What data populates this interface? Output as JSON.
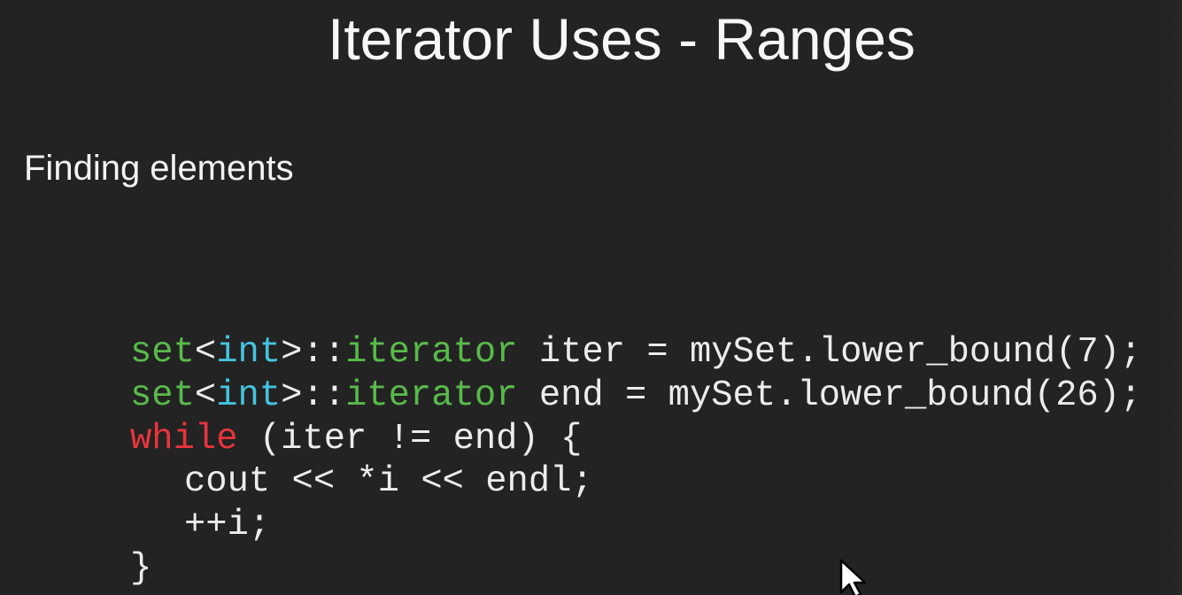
{
  "slide": {
    "title": "Iterator Uses - Ranges",
    "subtitle": "Finding elements"
  },
  "code": {
    "line1": {
      "type": "set",
      "lt": "<",
      "int": "int",
      "gt_scope": ">::",
      "iterator": "iterator",
      "rest": " iter = mySet.lower_bound(7);"
    },
    "line2": {
      "type": "set",
      "lt": "<",
      "int": "int",
      "gt_scope": ">::",
      "iterator": "iterator",
      "rest": " end = mySet.lower_bound(26);"
    },
    "line3": {
      "keyword": "while",
      "rest": " (iter != end) {"
    },
    "line4": "cout << *i << endl;",
    "line5": "++i;",
    "line6": "}"
  },
  "colors": {
    "background": "#232323",
    "text": "#f4f4f4",
    "type_green": "#58ba4a",
    "int_cyan": "#45c3dd",
    "keyword_red": "#e8343c"
  },
  "icons": {
    "cursor": "mouse-pointer-icon"
  }
}
